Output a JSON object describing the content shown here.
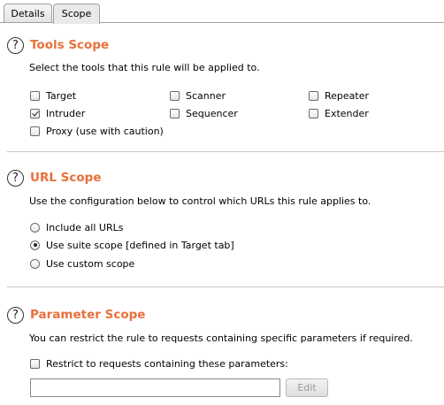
{
  "tabs": [
    {
      "label": "Details",
      "active": false
    },
    {
      "label": "Scope",
      "active": true
    }
  ],
  "tools_scope": {
    "title": "Tools Scope",
    "description": "Select the tools that this rule will be applied to.",
    "tools": [
      {
        "label": "Target",
        "checked": false
      },
      {
        "label": "Scanner",
        "checked": false
      },
      {
        "label": "Repeater",
        "checked": false
      },
      {
        "label": "Intruder",
        "checked": true
      },
      {
        "label": "Sequencer",
        "checked": false
      },
      {
        "label": "Extender",
        "checked": false
      },
      {
        "label": "Proxy (use with caution)",
        "checked": false
      }
    ]
  },
  "url_scope": {
    "title": "URL Scope",
    "description": "Use the configuration below to control which URLs this rule applies to.",
    "options": [
      {
        "label": "Include all URLs",
        "selected": false
      },
      {
        "label": "Use suite scope [defined in Target tab]",
        "selected": true
      },
      {
        "label": "Use custom scope",
        "selected": false
      }
    ]
  },
  "parameter_scope": {
    "title": "Parameter Scope",
    "description": "You can restrict the rule to requests containing specific parameters if required.",
    "restrict_label": "Restrict to requests containing these parameters:",
    "restrict_checked": false,
    "parameter_value": "",
    "edit_label": "Edit"
  },
  "help_glyph": "?",
  "colors": {
    "section_title": "#e8703a"
  }
}
